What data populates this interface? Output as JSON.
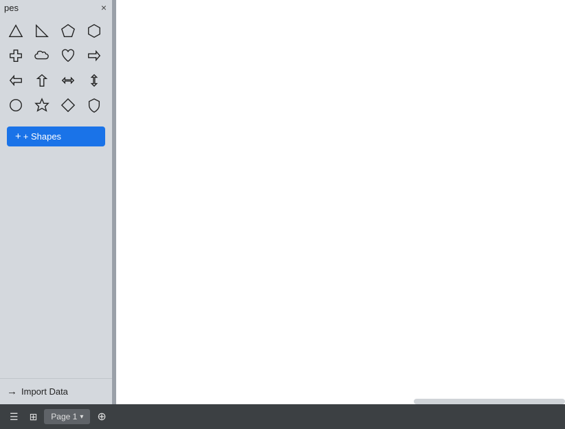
{
  "sidebar": {
    "title": "pes",
    "close_label": "×",
    "shapes": [
      {
        "name": "triangle",
        "symbol": "△"
      },
      {
        "name": "right-triangle",
        "symbol": "◺"
      },
      {
        "name": "pentagon",
        "symbol": "⬠"
      },
      {
        "name": "hexagon",
        "symbol": "⬡"
      },
      {
        "name": "cross",
        "symbol": "✚"
      },
      {
        "name": "cloud",
        "symbol": "☁"
      },
      {
        "name": "heart",
        "symbol": "♡"
      },
      {
        "name": "arrow-right",
        "symbol": "⇒"
      },
      {
        "name": "arrow-left",
        "symbol": "⇐"
      },
      {
        "name": "arrow-up",
        "symbol": "↑"
      },
      {
        "name": "arrow-both-h",
        "symbol": "⇔"
      },
      {
        "name": "arrow-both-v",
        "symbol": "↕"
      },
      {
        "name": "circle",
        "symbol": "○"
      },
      {
        "name": "star",
        "symbol": "☆"
      },
      {
        "name": "diamond",
        "symbol": "◇"
      },
      {
        "name": "shield",
        "symbol": "⬡"
      }
    ],
    "add_shapes_label": "+ Shapes",
    "import_data_label": "Import Data"
  },
  "toolbar": {
    "list_icon": "☰",
    "grid_icon": "⊞",
    "page_label": "Page 1",
    "chevron": "▾",
    "add_icon": "⊕"
  },
  "colors": {
    "add_shapes_bg": "#1a73e8",
    "sidebar_bg": "#d4d8dd",
    "handle_bg": "#9aa0a8",
    "canvas_bg": "#ffffff",
    "toolbar_bg": "#3c4043"
  }
}
